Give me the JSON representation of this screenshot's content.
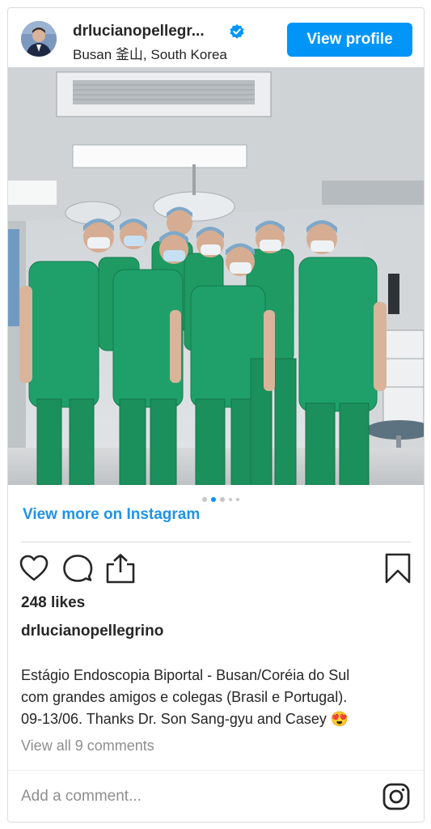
{
  "post": {
    "username": "drlucianopellegr...",
    "location": "Busan 釜山, South Korea",
    "view_profile_label": "View profile",
    "view_more_label": "View more on Instagram",
    "carousel": {
      "count": 5,
      "active_index": 1
    },
    "likes_text": "248 likes",
    "caption_author": "drlucianopellegrino",
    "caption_lines": [
      "Estágio Endoscopia Biportal - Busan/Coréia do Sul",
      "com grandes amigos e colegas (Brasil e Portugal).",
      "09-13/06. Thanks Dr. Son Sang-gyu and Casey 😍"
    ],
    "view_comments_label": "View all 9 comments",
    "comment_placeholder": "Add a comment..."
  },
  "colors": {
    "accent": "#0095f6",
    "link": "#1f93e6",
    "scrubs": "#1f9a63",
    "muted": "#8e8e8e"
  },
  "icons": {
    "verified": "verified-badge-icon",
    "like": "heart-icon",
    "comment": "comment-bubble-icon",
    "share": "share-upload-icon",
    "save": "bookmark-icon",
    "instagram": "instagram-logo-icon"
  }
}
